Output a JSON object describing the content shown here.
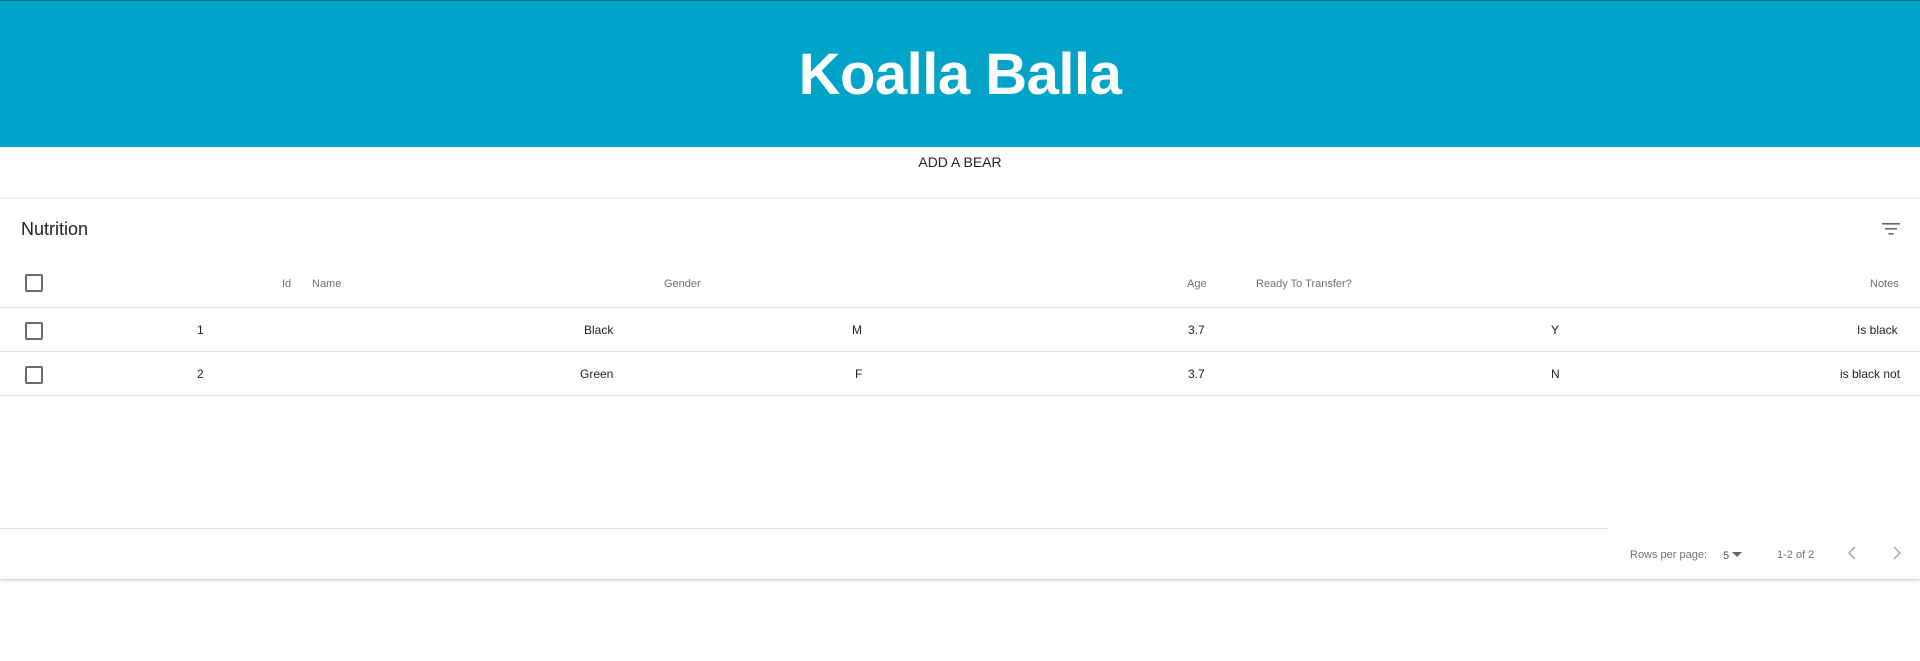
{
  "app": {
    "title": "Koalla Balla"
  },
  "actions": {
    "add_bear": "ADD A BEAR"
  },
  "table": {
    "title": "Nutrition",
    "columns": {
      "id": "Id",
      "name": "Name",
      "gender": "Gender",
      "age": "Age",
      "ready": "Ready To Transfer?",
      "notes": "Notes"
    },
    "rows": [
      {
        "id": "1",
        "name": "Black",
        "gender": "M",
        "age": "3.7",
        "ready": "Y",
        "notes": "Is black"
      },
      {
        "id": "2",
        "name": "Green",
        "gender": "F",
        "age": "3.7",
        "ready": "N",
        "notes": "is black not"
      }
    ]
  },
  "pagination": {
    "rows_per_page_label": "Rows per page:",
    "rows_per_page_value": "5",
    "range": "1-2 of 2"
  },
  "colors": {
    "header_bg": "#00a4c8",
    "header_text": "#ffffff"
  },
  "icons": {
    "filter": "filter-list-icon",
    "prev": "chevron-left-icon",
    "next": "chevron-right-icon",
    "dropdown": "caret-down-icon"
  }
}
